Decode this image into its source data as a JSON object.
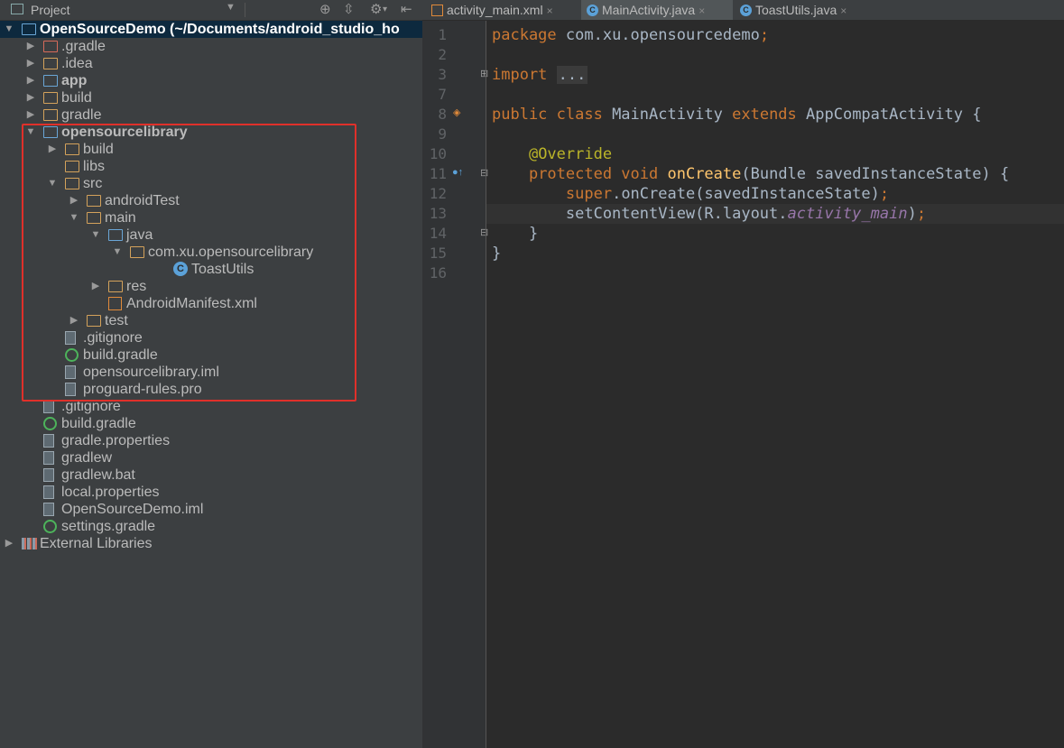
{
  "project_panel": {
    "title": "Project",
    "tree": [
      {
        "label": "OpenSourceDemo (~/Documents/android_studio_ho",
        "depth": 0,
        "arrow": "down",
        "icon": "module-folder",
        "bold": true,
        "selected": true
      },
      {
        "label": ".gradle",
        "depth": 1,
        "arrow": "right",
        "icon": "folder-red"
      },
      {
        "label": ".idea",
        "depth": 1,
        "arrow": "right",
        "icon": "folder"
      },
      {
        "label": "app",
        "depth": 1,
        "arrow": "right",
        "icon": "module-folder",
        "bold": true
      },
      {
        "label": "build",
        "depth": 1,
        "arrow": "right",
        "icon": "folder"
      },
      {
        "label": "gradle",
        "depth": 1,
        "arrow": "right",
        "icon": "folder"
      },
      {
        "label": "opensourcelibrary",
        "depth": 1,
        "arrow": "down",
        "icon": "module-folder",
        "bold": true
      },
      {
        "label": "build",
        "depth": 2,
        "arrow": "right",
        "icon": "folder"
      },
      {
        "label": "libs",
        "depth": 2,
        "arrow": "",
        "icon": "folder"
      },
      {
        "label": "src",
        "depth": 2,
        "arrow": "down",
        "icon": "folder"
      },
      {
        "label": "androidTest",
        "depth": 3,
        "arrow": "right",
        "icon": "folder"
      },
      {
        "label": "main",
        "depth": 3,
        "arrow": "down",
        "icon": "folder"
      },
      {
        "label": "java",
        "depth": 4,
        "arrow": "down",
        "icon": "folder-blue"
      },
      {
        "label": "com.xu.opensourcelibrary",
        "depth": 5,
        "arrow": "down",
        "icon": "folder"
      },
      {
        "label": "ToastUtils",
        "depth": 7,
        "arrow": "",
        "icon": "class"
      },
      {
        "label": "res",
        "depth": 4,
        "arrow": "right",
        "icon": "folder-res"
      },
      {
        "label": "AndroidManifest.xml",
        "depth": 4,
        "arrow": "",
        "icon": "xml"
      },
      {
        "label": "test",
        "depth": 3,
        "arrow": "right",
        "icon": "folder"
      },
      {
        "label": ".gitignore",
        "depth": 2,
        "arrow": "",
        "icon": "file"
      },
      {
        "label": "build.gradle",
        "depth": 2,
        "arrow": "",
        "icon": "gradle"
      },
      {
        "label": "opensourcelibrary.iml",
        "depth": 2,
        "arrow": "",
        "icon": "file"
      },
      {
        "label": "proguard-rules.pro",
        "depth": 2,
        "arrow": "",
        "icon": "file"
      },
      {
        "label": ".gitignore",
        "depth": 1,
        "arrow": "",
        "icon": "file"
      },
      {
        "label": "build.gradle",
        "depth": 1,
        "arrow": "",
        "icon": "gradle"
      },
      {
        "label": "gradle.properties",
        "depth": 1,
        "arrow": "",
        "icon": "file"
      },
      {
        "label": "gradlew",
        "depth": 1,
        "arrow": "",
        "icon": "file"
      },
      {
        "label": "gradlew.bat",
        "depth": 1,
        "arrow": "",
        "icon": "file"
      },
      {
        "label": "local.properties",
        "depth": 1,
        "arrow": "",
        "icon": "file"
      },
      {
        "label": "OpenSourceDemo.iml",
        "depth": 1,
        "arrow": "",
        "icon": "file"
      },
      {
        "label": "settings.gradle",
        "depth": 1,
        "arrow": "",
        "icon": "gradle"
      },
      {
        "label": "External Libraries",
        "depth": 0,
        "arrow": "right",
        "icon": "libraries"
      }
    ]
  },
  "editor": {
    "tabs": [
      {
        "label": "activity_main.xml",
        "icon": "xml",
        "active": false
      },
      {
        "label": "MainActivity.java",
        "icon": "class",
        "active": true
      },
      {
        "label": "ToastUtils.java",
        "icon": "class",
        "active": false
      }
    ],
    "close_glyph": "×",
    "lines": [
      {
        "n": "1",
        "tokens": [
          {
            "t": "package ",
            "c": "kw"
          },
          {
            "t": "com.xu.opensourcedemo",
            "c": ""
          },
          {
            "t": ";",
            "c": "kw"
          }
        ]
      },
      {
        "n": "2",
        "tokens": []
      },
      {
        "n": "3",
        "tokens": [
          {
            "t": "import ",
            "c": "kw"
          },
          {
            "t": "...",
            "c": "fold"
          }
        ]
      },
      {
        "n": "7",
        "tokens": []
      },
      {
        "n": "8",
        "tokens": [
          {
            "t": "public class ",
            "c": "kw"
          },
          {
            "t": "MainActivity ",
            "c": ""
          },
          {
            "t": "extends ",
            "c": "kw"
          },
          {
            "t": "AppCompatActivity {",
            "c": ""
          }
        ]
      },
      {
        "n": "9",
        "tokens": []
      },
      {
        "n": "10",
        "tokens": [
          {
            "t": "    ",
            "c": ""
          },
          {
            "t": "@Override",
            "c": "ann"
          }
        ]
      },
      {
        "n": "11",
        "tokens": [
          {
            "t": "    ",
            "c": ""
          },
          {
            "t": "protected void ",
            "c": "kw"
          },
          {
            "t": "onCreate",
            "c": "fn"
          },
          {
            "t": "(Bundle savedInstanceState) {",
            "c": ""
          }
        ]
      },
      {
        "n": "12",
        "tokens": [
          {
            "t": "        ",
            "c": ""
          },
          {
            "t": "super",
            "c": "kw"
          },
          {
            "t": ".onCreate(savedInstanceState)",
            "c": ""
          },
          {
            "t": ";",
            "c": "kw"
          }
        ]
      },
      {
        "n": "13",
        "tokens": [
          {
            "t": "        setContentView(R.layout.",
            "c": ""
          },
          {
            "t": "activity_main",
            "c": "it"
          },
          {
            "t": ")",
            "c": ""
          },
          {
            "t": ";",
            "c": "kw"
          }
        ]
      },
      {
        "n": "14",
        "tokens": [
          {
            "t": "    }",
            "c": ""
          }
        ]
      },
      {
        "n": "15",
        "tokens": [
          {
            "t": "}",
            "c": ""
          }
        ]
      },
      {
        "n": "16",
        "tokens": []
      }
    ]
  },
  "colors": {
    "highlight_box": "#e0302a",
    "selection": "#0d293e",
    "editor_bg": "#2b2b2b",
    "panel_bg": "#3c3f41"
  }
}
